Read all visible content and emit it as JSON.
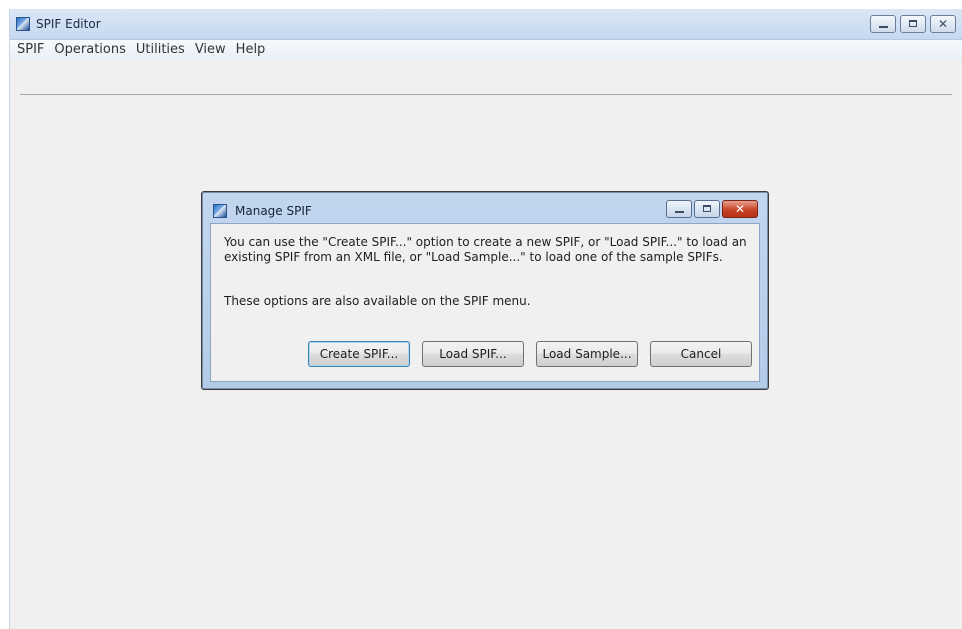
{
  "window": {
    "title": "SPIF Editor",
    "icon": "spif-editor-app-icon",
    "controls": {
      "minimize": "minimize-icon",
      "maximize": "maximize-icon",
      "close": "✕"
    }
  },
  "menubar": {
    "items": [
      {
        "label": "SPIF"
      },
      {
        "label": "Operations"
      },
      {
        "label": "Utilities"
      },
      {
        "label": "View"
      },
      {
        "label": "Help"
      }
    ]
  },
  "dialog": {
    "title": "Manage SPIF",
    "message": "You can use the \"Create SPIF...\" option to create a new SPIF, or \"Load SPIF...\" to load an existing SPIF from an XML file, or \"Load Sample...\" to load one of the sample SPIFs.",
    "note": "These options are also available on the SPIF menu.",
    "close_glyph": "✕",
    "buttons": {
      "create": "Create SPIF...",
      "load": "Load SPIF...",
      "sample": "Load Sample...",
      "cancel": "Cancel"
    }
  },
  "colors": {
    "titlebar": "#c6d8f0",
    "dialog_close": "#c7452b",
    "workspace": "#f0f0f0"
  }
}
